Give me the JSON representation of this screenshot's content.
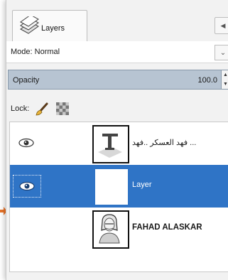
{
  "tab": {
    "label": "Layers",
    "icon": "layers-icon"
  },
  "mode": {
    "label": "Mode: Normal"
  },
  "opacity": {
    "label": "Opacity",
    "value": "100.0"
  },
  "lock": {
    "label": "Lock:"
  },
  "layers": [
    {
      "name": "فهد العسكر ..فهد ...",
      "visible": true,
      "selected": false,
      "thumb": "text-layer-icon"
    },
    {
      "name": "Layer",
      "visible": true,
      "selected": true,
      "thumb": "blank-white"
    },
    {
      "name": "FAHAD ALASKAR",
      "visible": false,
      "selected": false,
      "thumb": "portrait-sketch"
    }
  ],
  "colors": {
    "selection": "#2f74c6",
    "opacity_bar": "#b7c4d2",
    "pointer_arrow": "#e8742a"
  }
}
